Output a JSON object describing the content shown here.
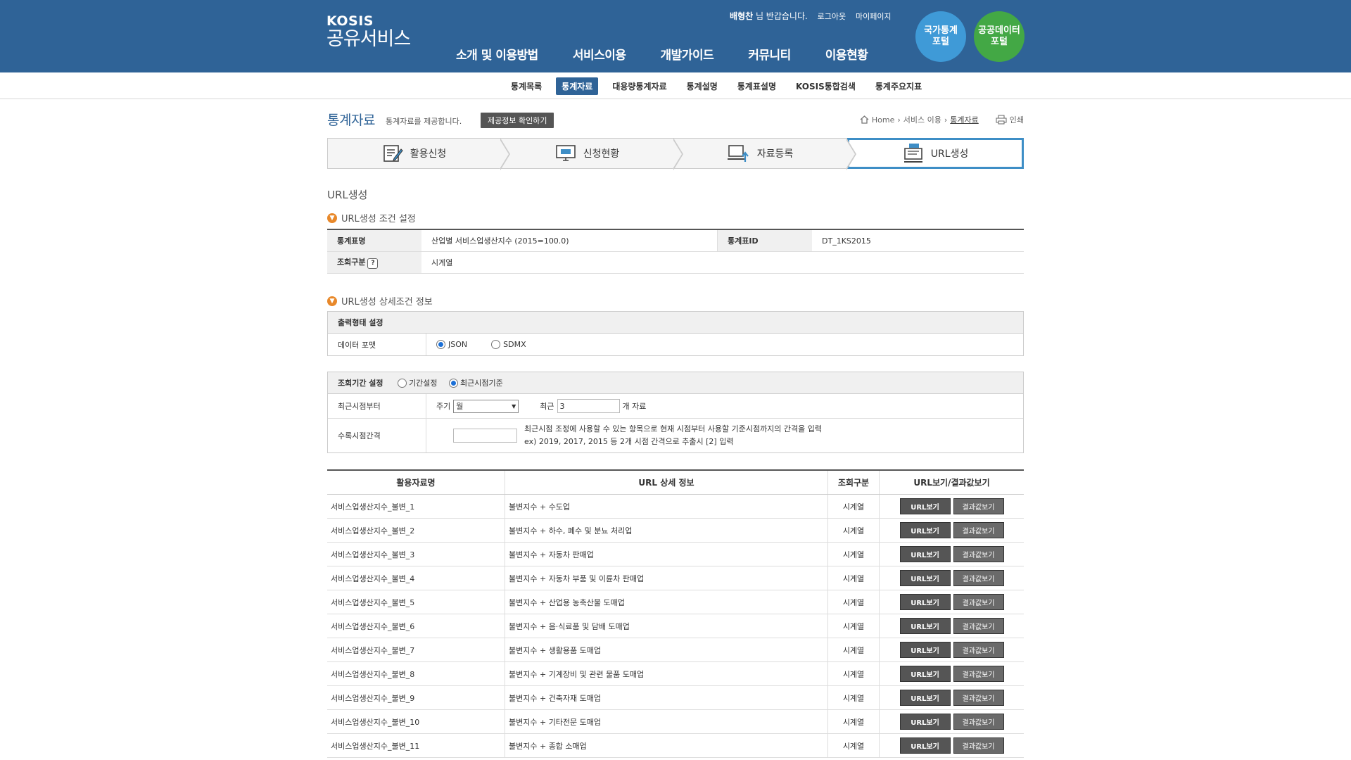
{
  "header": {
    "logo_top": "KOSIS",
    "logo_bottom": "공유서비스",
    "user_name": "배형찬",
    "greeting": " 님 반갑습니다.",
    "logout": "로그아웃",
    "mypage": "마이페이지",
    "gnb": [
      "소개 및 이용방법",
      "서비스이용",
      "개발가이드",
      "커뮤니티",
      "이용현황"
    ],
    "portal1": "국가통계\n포털",
    "portal2": "공공데이터\n포털",
    "portal1_color": "#3f9ad7",
    "portal2_color": "#43a845"
  },
  "subnav": {
    "items": [
      "통계목록",
      "통계자료",
      "대용량통계자료",
      "통계설명",
      "통계표설명",
      "KOSIS통합검색",
      "통계주요지표"
    ],
    "active_index": 1
  },
  "page": {
    "title": "통계자료",
    "desc": "통계자료를 제공합니다.",
    "info_button": "제공정보 확인하기",
    "crumb": [
      "Home",
      "서비스 이용",
      "통계자료"
    ],
    "print": "인쇄"
  },
  "steps": [
    {
      "label": "활용신청",
      "icon": "edit-doc-icon"
    },
    {
      "label": "신청현황",
      "icon": "monitor-icon"
    },
    {
      "label": "자료등록",
      "icon": "upload-icon"
    },
    {
      "label": "URL생성",
      "icon": "url-computer-icon"
    }
  ],
  "section_title": "URL생성",
  "cond": {
    "heading": "URL생성 조건 설정",
    "table_name_label": "통계표명",
    "table_name_value": "산업별 서비스업생산지수 (2015=100.0)",
    "table_id_label": "통계표ID",
    "table_id_value": "DT_1KS2015",
    "query_type_label": "조회구분",
    "query_type_help": "?",
    "query_type_value": "시계열"
  },
  "detail": {
    "heading": "URL생성 상세조건 정보",
    "output_heading": "출력형태 설정",
    "format_label": "데이터 포맷",
    "format_options": [
      "JSON",
      "SDMX"
    ],
    "format_selected": "JSON",
    "period_heading": "조회기간 설정",
    "period_options": [
      "기간설정",
      "최근시점기준"
    ],
    "period_selected": "최근시점기준",
    "recent_label": "최근시점부터",
    "cycle_label": "주기",
    "cycle_value": "월",
    "recent_prefix": "최근",
    "recent_value": "3",
    "recent_suffix": "개 자료",
    "interval_label": "수록시점간격",
    "interval_value": "",
    "interval_help1": "최근시점 조정에 사용할 수 있는 항목으로 현재 시점부터 사용할 기준시점까지의 간격을 입력",
    "interval_help2": "ex) 2019, 2017, 2015 등 2개 시점 간격으로 추출시 [2] 입력"
  },
  "table": {
    "headers": [
      "활용자료명",
      "URL 상세 정보",
      "조회구분",
      "URL보기/결과값보기"
    ],
    "url_button": "URL보기",
    "result_button": "결과값보기",
    "rows": [
      {
        "name": "서비스업생산지수_불변_1",
        "detail": "불변지수 + 수도업",
        "type": "시계열"
      },
      {
        "name": "서비스업생산지수_불변_2",
        "detail": "불변지수 + 하수, 폐수 및 분뇨 처리업",
        "type": "시계열"
      },
      {
        "name": "서비스업생산지수_불변_3",
        "detail": "불변지수 + 자동차 판매업",
        "type": "시계열"
      },
      {
        "name": "서비스업생산지수_불변_4",
        "detail": "불변지수 + 자동차 부품 및 이륜차 판매업",
        "type": "시계열"
      },
      {
        "name": "서비스업생산지수_불변_5",
        "detail": "불변지수 + 산업용 농축산물 도매업",
        "type": "시계열"
      },
      {
        "name": "서비스업생산지수_불변_6",
        "detail": "불변지수 + 음·식료품 및 담배 도매업",
        "type": "시계열"
      },
      {
        "name": "서비스업생산지수_불변_7",
        "detail": "불변지수 + 생활용품 도매업",
        "type": "시계열"
      },
      {
        "name": "서비스업생산지수_불변_8",
        "detail": "불변지수 + 기계장비 및 관련 물품 도매업",
        "type": "시계열"
      },
      {
        "name": "서비스업생산지수_불변_9",
        "detail": "불변지수 + 건축자재 도매업",
        "type": "시계열"
      },
      {
        "name": "서비스업생산지수_불변_10",
        "detail": "불변지수 + 기타전문 도매업",
        "type": "시계열"
      },
      {
        "name": "서비스업생산지수_불변_11",
        "detail": "불변지수 + 종합 소매업",
        "type": "시계열"
      }
    ]
  }
}
